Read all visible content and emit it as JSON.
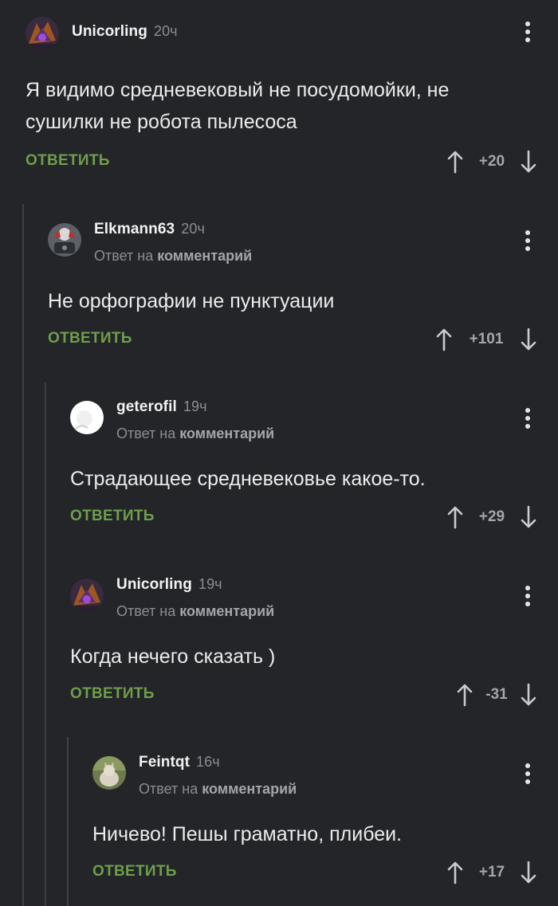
{
  "comments": [
    {
      "username": "Unicorling",
      "time": "20ч",
      "reply_prefix": "",
      "reply_target": "",
      "text": "Я видимо средневековый не посудомойки, не сушилки не робота пылесоса",
      "reply_label": "ОТВЕТИТЬ",
      "rating": "+20"
    },
    {
      "username": "Elkmann63",
      "time": "20ч",
      "reply_prefix": "Ответ на ",
      "reply_target": "комментарий",
      "text": "Не орфографии не пунктуации",
      "reply_label": "ОТВЕТИТЬ",
      "rating": "+101"
    },
    {
      "username": "geterofil",
      "time": "19ч",
      "reply_prefix": "Ответ на ",
      "reply_target": "комментарий",
      "text": "Страдающее средневековье какое-то.",
      "reply_label": "ОТВЕТИТЬ",
      "rating": "+29"
    },
    {
      "username": "Unicorling",
      "time": "19ч",
      "reply_prefix": "Ответ на ",
      "reply_target": "комментарий",
      "text": "Когда нечего сказать )",
      "reply_label": "ОТВЕТИТЬ",
      "rating": "-31"
    },
    {
      "username": "Feintqt",
      "time": "16ч",
      "reply_prefix": "Ответ на ",
      "reply_target": "комментарий",
      "text": "Ничево! Пешы граматно, плибеи.",
      "reply_label": "ОТВЕТИТЬ",
      "rating": "+17"
    }
  ],
  "colors": {
    "background": "#232528",
    "accent_green": "#6f9e4c",
    "muted_text": "#8a8d91",
    "thread_line": "#3d4045"
  },
  "icons": {
    "more": "more-vertical-icon",
    "upvote": "arrow-up-icon",
    "downvote": "arrow-down-icon"
  }
}
